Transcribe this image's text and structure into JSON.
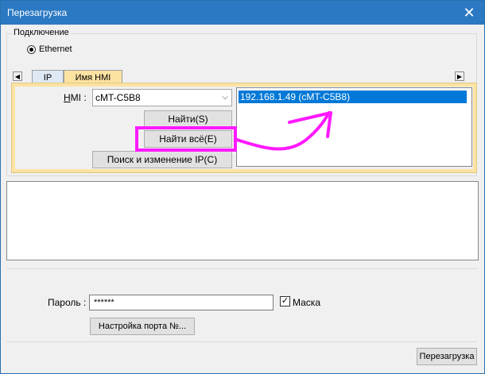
{
  "window": {
    "title": "Перезагрузка",
    "close_glyph": "✕"
  },
  "connection": {
    "legend": "Подключение",
    "radio_label": "Ethernet",
    "scroll_left_glyph": "◀",
    "scroll_right_glyph": "▶"
  },
  "tabs": [
    {
      "label": "IP"
    },
    {
      "label": "Имя HMI"
    }
  ],
  "hmi": {
    "label_prefix": "H",
    "label_rest": "MI :",
    "selected": "cMT-C5B8",
    "dropdown_glyph": "⌵",
    "find_button": "Найти(S)",
    "find_all_button": "Найти всё(E)",
    "search_change_ip_button": "Поиск и изменение IP(C)",
    "devices": [
      "192.168.1.49 (cMT-C5B8)"
    ]
  },
  "password": {
    "label": "Пароль :",
    "value": "******",
    "mask_label": "Маска",
    "mask_checked_glyph": "✓",
    "port_settings_button": "Настройка порта №..."
  },
  "footer": {
    "reboot_button": "Перезагрузка"
  },
  "colors": {
    "title_bar": "#2b79c2",
    "tab_active": "#fce3a2",
    "selection": "#0078d7",
    "annotation": "#ff19ff"
  }
}
